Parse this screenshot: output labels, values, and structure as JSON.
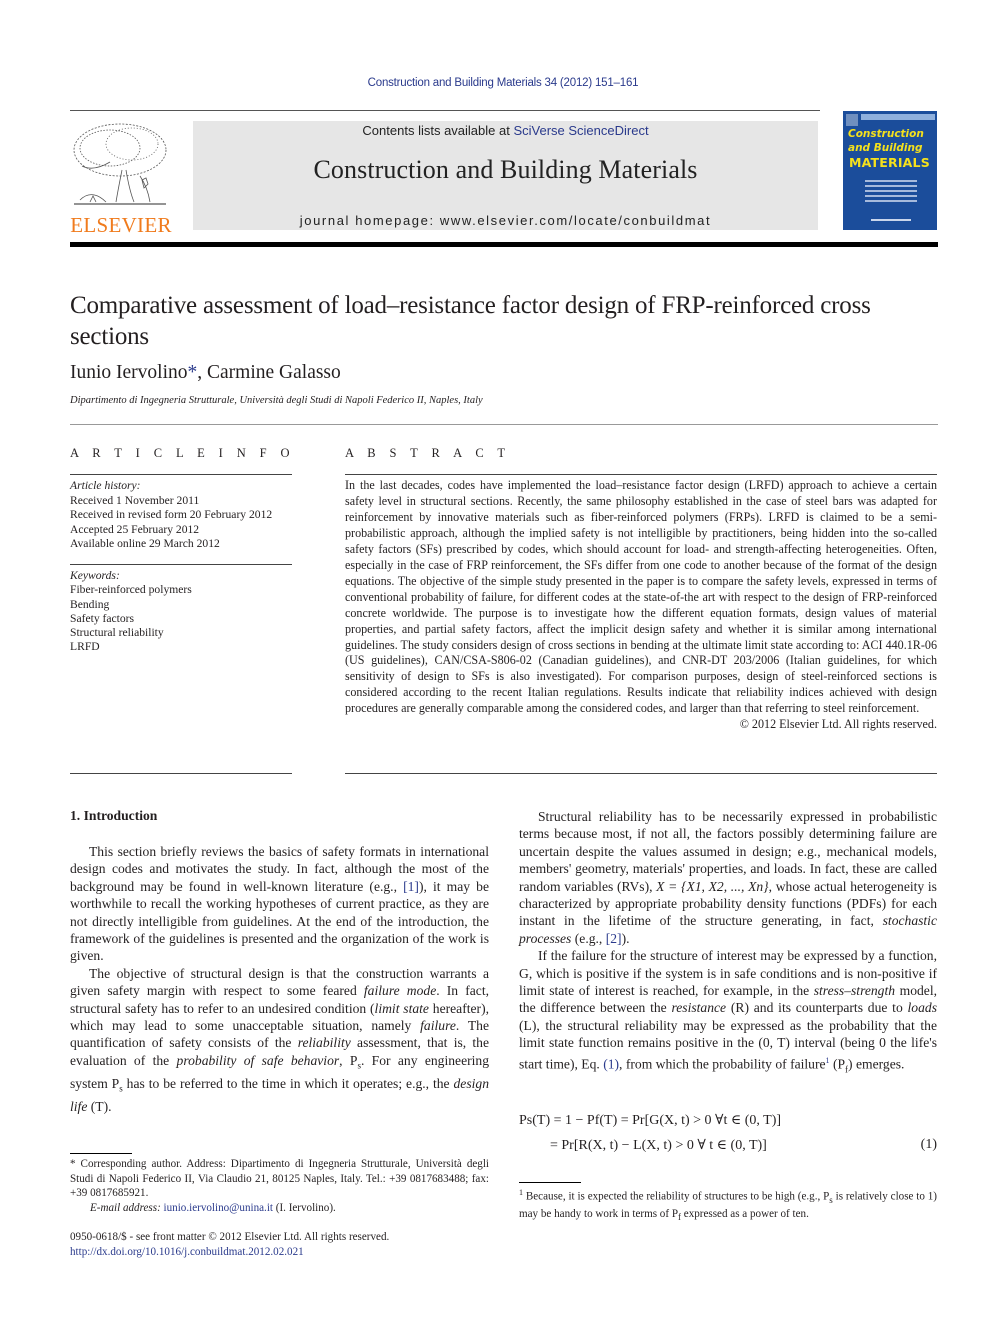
{
  "header": {
    "journal_reference": "Construction and Building Materials 34 (2012) 151–161",
    "publisher_logo_text": "ELSEVIER",
    "contents_prefix": "Contents lists available at ",
    "contents_link": "SciVerse ScienceDirect",
    "journal_title": "Construction and Building Materials",
    "homepage": "journal homepage: www.elsevier.com/locate/conbuildmat",
    "cover": {
      "line1": "Construction",
      "line2": "and Building",
      "line3": "MATERIALS",
      "background_color": "#1b4d9b",
      "title_color": "#f5e11c"
    },
    "logo_color": "#f07b1d",
    "link_color": "#2a3a8c"
  },
  "article": {
    "title": "Comparative assessment of load–resistance factor design of FRP-reinforced cross sections",
    "authors": [
      {
        "name": "Iunio Iervolino",
        "mark": "*"
      },
      {
        "name": "Carmine Galasso",
        "mark": ""
      }
    ],
    "author_separator": ", ",
    "affiliation": "Dipartimento di Ingegneria Strutturale, Università degli Studi di Napoli Federico II, Naples, Italy"
  },
  "article_info": {
    "label": "ARTICLE INFO",
    "history_label": "Article history:",
    "history": [
      "Received 1 November 2011",
      "Received in revised form 20 February 2012",
      "Accepted 25 February 2012",
      "Available online 29 March 2012"
    ],
    "keywords_label": "Keywords:",
    "keywords": [
      "Fiber-reinforced polymers",
      "Bending",
      "Safety factors",
      "Structural reliability",
      "LRFD"
    ]
  },
  "abstract": {
    "label": "ABSTRACT",
    "text": "In the last decades, codes have implemented the load–resistance factor design (LRFD) approach to achieve a certain safety level in structural sections. Recently, the same philosophy established in the case of steel bars was adapted for reinforcement by innovative materials such as fiber-reinforced polymers (FRPs). LRFD is claimed to be a semi-probabilistic approach, although the implied safety is not intelligible by practitioners, being hidden into the so-called safety factors (SFs) prescribed by codes, which should account for load- and strength-affecting heterogeneities. Often, especially in the case of FRP reinforcement, the SFs differ from one code to another because of the format of the design equations. The objective of the simple study presented in the paper is to compare the safety levels, expressed in terms of conventional probability of failure, for different codes at the state-of-the art with respect to the design of FRP-reinforced concrete worldwide. The purpose is to investigate how the different equation formats, design values of material properties, and partial safety factors, affect the implicit design safety and whether it is similar among international guidelines. The study considers design of cross sections in bending at the ultimate limit state according to: ACI 440.1R-06 (US guidelines), CAN/CSA-S806-02 (Canadian guidelines), and CNR-DT 203/2006 (Italian guidelines, for which sensitivity of design to SFs is also investigated). For comparison purposes, design of steel-reinforced sections is considered according to the recent Italian regulations. Results indicate that reliability indices achieved with design procedures are generally comparable among the considered codes, and larger than that referring to steel reinforcement.",
    "copyright": "© 2012 Elsevier Ltd. All rights reserved."
  },
  "body": {
    "section_heading": "1. Introduction",
    "col1": {
      "p1_a": "This section briefly reviews the basics of safety formats in international design codes and motivates the study. In fact, although the most of the background may be found in well-known literature (e.g., ",
      "p1_ref": "[1]",
      "p1_b": "), it may be worthwhile to recall the working hypotheses of current practice, as they are not directly intelligible from guidelines. At the end of the introduction, the framework of the guidelines is presented and the organization of the work is given.",
      "p2_a": "The objective of structural design is that the construction warrants a given safety margin with respect to some feared ",
      "p2_i1": "failure mode",
      "p2_b": ". In fact, structural safety has to refer to an undesired condition (",
      "p2_i2": "limit state",
      "p2_c": " hereafter), which may lead to some unacceptable situation, namely ",
      "p2_i3": "failure",
      "p2_d": ". The quantification of safety consists of the ",
      "p2_i4": "reliability",
      "p2_e": " assessment, that is, the evaluation of the ",
      "p2_i5": "probability of safe behavior",
      "p2_f": ", P",
      "p2_sub1": "s",
      "p2_g": ". For any engineering system P",
      "p2_sub2": "s",
      "p2_h": " has to be referred to the time in which it operates; e.g., the ",
      "p2_i6": "design life",
      "p2_i": " (T)."
    },
    "col2": {
      "p1_a": "Structural reliability has to be necessarily expressed in probabilistic terms because most, if not all, the factors possibly determining failure are uncertain despite the values assumed in design; e.g., mechanical models, members' geometry, materials' properties, and loads. In fact, these are called random variables (RVs), ",
      "p1_math": "X = {X1, X2, ..., Xn}",
      "p1_b": ", whose actual heterogeneity is characterized by appropriate probability density functions (PDFs) for each instant in the lifetime of the structure generating, in fact, ",
      "p1_i1": "stochastic processes",
      "p1_c": " (e.g., ",
      "p1_ref": "[2]",
      "p1_d": ").",
      "p2_a": "If the failure for the structure of interest may be expressed by a function, G, which is positive if the system is in safe conditions and is non-positive if limit state of interest is reached, for example, in the ",
      "p2_i1": "stress–strength",
      "p2_b": " model, the difference between the ",
      "p2_i2": "resistance",
      "p2_c": " (R) and its counterparts due to ",
      "p2_i3": "loads",
      "p2_d": " (L), the structural reliability may be expressed as the probability that the limit state function remains positive in the (0, T) interval (being 0 the life's start time), Eq. ",
      "p2_ref": "(1)",
      "p2_e": ", from which the probability of failure",
      "p2_sup": "1",
      "p2_f": " (P",
      "p2_sub": "f",
      "p2_g": ") emerges."
    },
    "equation": {
      "line1": "Ps(T) = 1 − Pf(T) = Pr[G(X, t) > 0 ∀t ∈ (0, T)]",
      "line2": "= Pr[R(X, t) − L(X, t) > 0 ∀ t ∈ (0, T)]",
      "number": "(1)"
    }
  },
  "footnotes": {
    "corresponding": "* Corresponding author. Address: Dipartimento di Ingegneria Strutturale, Università degli Studi di Napoli Federico II, Via Claudio 21, 80125 Naples, Italy. Tel.: +39 0817683488; fax: +39 0817685921.",
    "email_label": "E-mail address: ",
    "email": "iunio.iervolino@unina.it",
    "email_suffix": " (I. Iervolino).",
    "fn1_mark": "1",
    "fn1_text_a": "Because, it is expected the reliability of structures to be high (e.g., P",
    "fn1_sub1": "s",
    "fn1_text_b": " is relatively close to 1) may be handy to work in terms of P",
    "fn1_sub2": "f",
    "fn1_text_c": " expressed as a power of ten."
  },
  "front_matter": {
    "issn_line": "0950-0618/$ - see front matter © 2012 Elsevier Ltd. All rights reserved.",
    "doi": "http://dx.doi.org/10.1016/j.conbuildmat.2012.02.021"
  }
}
